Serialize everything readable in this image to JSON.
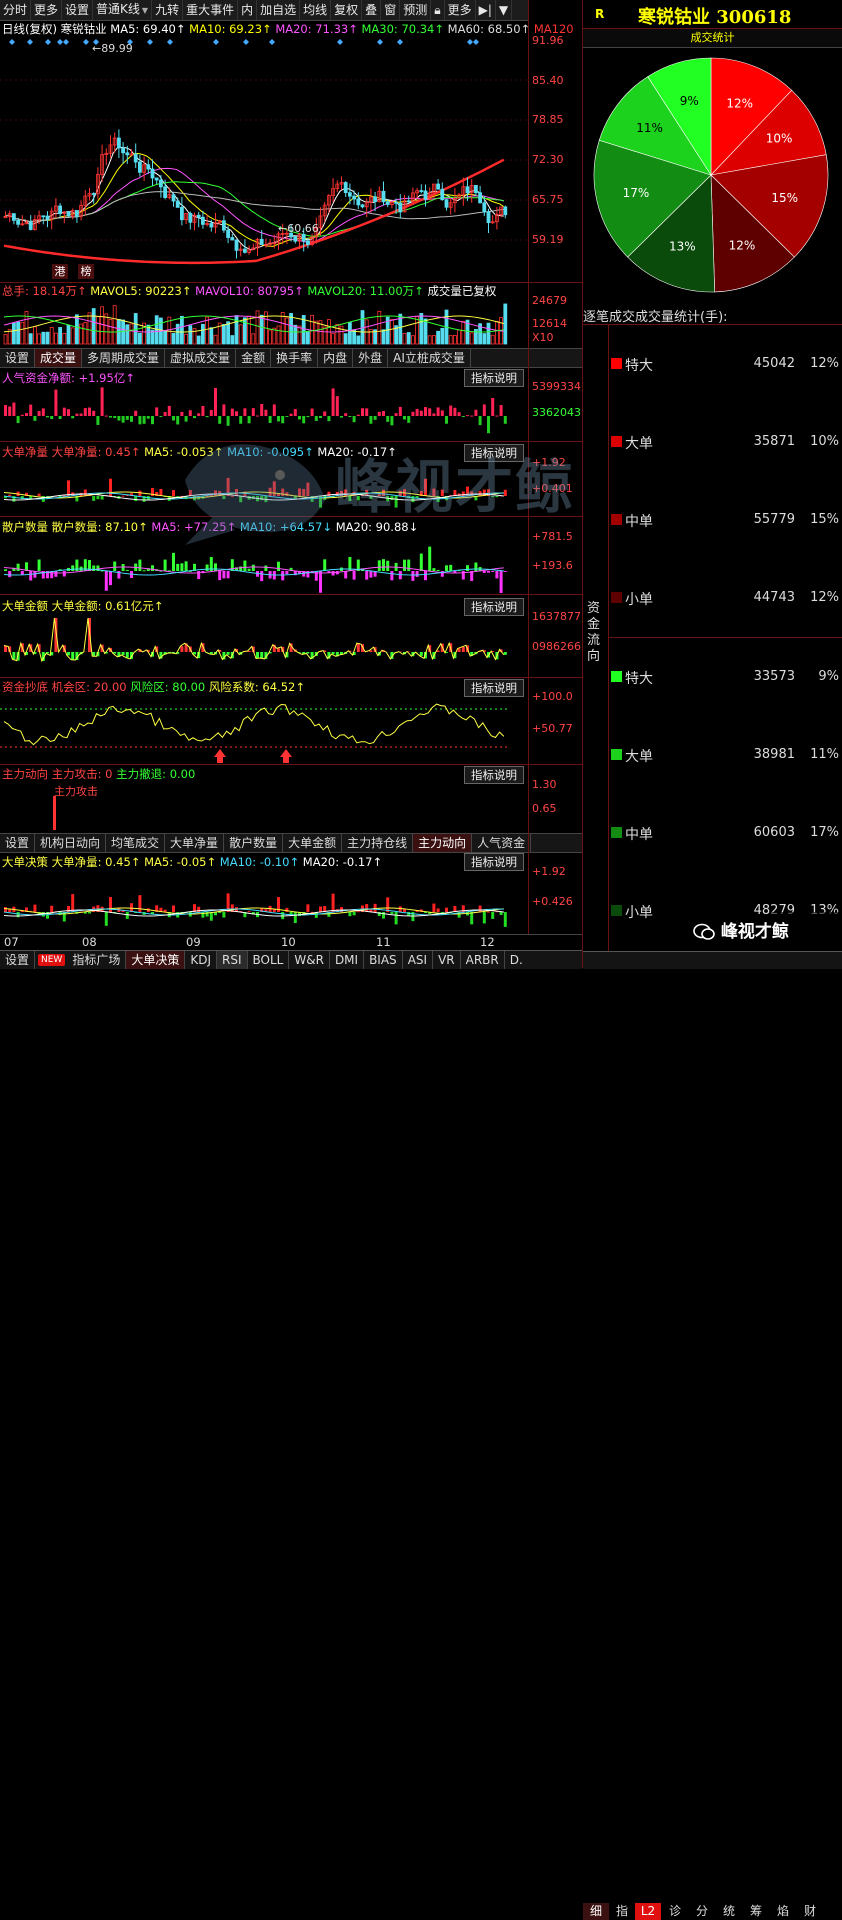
{
  "toolbar": {
    "items": [
      "分时",
      "更多",
      "设置",
      "普通K线",
      "九转",
      "重大事件",
      "内",
      "加自选",
      "均线",
      "复权",
      "叠",
      "窗",
      "预测",
      "更多"
    ]
  },
  "main_chart": {
    "legend": {
      "type": "日线(复权)",
      "name": "寒锐钴业",
      "ma5": "MA5: 69.40↑",
      "ma10": "MA10: 69.23↑",
      "ma20": "MA20: 71.33↑",
      "ma30": "MA30: 70.34↑",
      "ma60": "MA60: 68.50↑",
      "ma120": "MA120"
    },
    "y_ticks": [
      "91.96",
      "85.40",
      "78.85",
      "72.30",
      "65.75",
      "59.19"
    ],
    "high_label": "89.99",
    "low_label": "60.66",
    "tags": [
      "港",
      "榜"
    ]
  },
  "volume_panel": {
    "legend": {
      "total": "总手: 18.14万↑",
      "mavol5": "MAVOL5: 90223↑",
      "mavol10": "MAVOL10: 80795↑",
      "mavol20": "MAVOL20: 11.00万↑",
      "note": "成交量已复权"
    },
    "y_ticks": [
      "24679",
      "12614",
      "X10"
    ]
  },
  "tabs1": [
    "设置",
    "成交量",
    "多周期成交量",
    "虚拟成交量",
    "金额",
    "换手率",
    "内盘",
    "外盘",
    "AI立桩成交量"
  ],
  "indicator_panels": [
    {
      "title": "人气资金净额: +1.95亿↑",
      "btn": "指标说明",
      "y1": "5399334",
      "y2": "3362043"
    },
    {
      "title": "大单净量  大单净量: 0.45↑",
      "ma5": "MA5: -0.053↑",
      "ma10": "MA10: -0.095↑",
      "ma20": "MA20: -0.17↑",
      "btn": "指标说明",
      "y1": "+1.92",
      "y2": "+0.401"
    },
    {
      "title": "散户数量  散户数量: 87.10↑",
      "ma5": "MA5: +77.25↑",
      "ma10": "MA10: +64.57↓",
      "ma20": "MA20: 90.88↓",
      "btn": "指标说明",
      "y1": "+781.5",
      "y2": "+193.6"
    },
    {
      "title": "大单金额  大单金额: 0.61亿元↑",
      "btn": "指标说明",
      "y1": "1637877",
      "y2": "0986266"
    },
    {
      "title": "资金抄底",
      "ma5": "机会区: 20.00",
      "ma10": "风险区: 80.00",
      "ma20": "风险系数: 64.52↑",
      "btn": "指标说明",
      "y1": "+100.0",
      "y2": "+50.77"
    },
    {
      "title": "主力动向",
      "ma5": "主力攻击: 0",
      "ma10": "主力撤退: 0.00",
      "btn": "指标说明",
      "y1": "1.30",
      "y2": "0.65",
      "note": "主力攻击"
    }
  ],
  "tabs2": [
    "设置",
    "机构日动向",
    "均笔成交",
    "大单净量",
    "散户数量",
    "大单金额",
    "主力持仓线",
    "主力动向",
    "人气资金"
  ],
  "decision_panel": {
    "title": "大单决策  大单净量: 0.45↑",
    "ma5": "MA5: -0.05↑",
    "ma10": "MA10: -0.10↑",
    "ma20": "MA20: -0.17↑",
    "btn": "指标说明",
    "y1": "+1.92",
    "y2": "+0.426"
  },
  "x_labels": [
    "07",
    "08",
    "09",
    "10",
    "11",
    "12"
  ],
  "bottom_tabs": [
    "设置",
    "NEW",
    "指标广场",
    "大单决策",
    "KDJ",
    "RSI",
    "BOLL",
    "W&R",
    "DMI",
    "BIAS",
    "ASI",
    "VR",
    "ARBR",
    "D."
  ],
  "right_panel": {
    "r_mark": "R",
    "title": "寒锐钴业 300618",
    "pie_title": "成交统计",
    "pie": [
      {
        "pct": "12%",
        "pct_value": 12,
        "color": "#ff0000"
      },
      {
        "pct": "10%",
        "pct_value": 10,
        "color": "#dd0000"
      },
      {
        "pct": "15%",
        "pct_value": 15,
        "color": "#a50000"
      },
      {
        "pct": "12%",
        "pct_value": 12,
        "color": "#5e0000"
      },
      {
        "pct": "13%",
        "pct_value": 13,
        "color": "#0a4a0a"
      },
      {
        "pct": "17%",
        "pct_value": 17,
        "color": "#128c12"
      },
      {
        "pct": "11%",
        "pct_value": 11,
        "color": "#1cd21c"
      },
      {
        "pct": "9%",
        "pct_value": 9,
        "color": "#22ff22"
      }
    ],
    "stats_title": "逐笔成交成交量统计(手):",
    "side_label": "资金流向",
    "rows": [
      {
        "label": "特大",
        "value": "45042",
        "pct": "12%",
        "color": "#ff0000"
      },
      {
        "label": "大单",
        "value": "35871",
        "pct": "10%",
        "color": "#dd0000"
      },
      {
        "label": "中单",
        "value": "55779",
        "pct": "15%",
        "color": "#a50000"
      },
      {
        "label": "小单",
        "value": "44743",
        "pct": "12%",
        "color": "#5e0000"
      },
      {
        "label": "特大",
        "value": "33573",
        "pct": "9%",
        "color": "#22ff22"
      },
      {
        "label": "大单",
        "value": "38981",
        "pct": "11%",
        "color": "#1cd21c"
      },
      {
        "label": "中单",
        "value": "60603",
        "pct": "17%",
        "color": "#128c12"
      },
      {
        "label": "小单",
        "value": "48279",
        "pct": "13%",
        "color": "#0a4a0a"
      }
    ],
    "watermark": "峰视才鲸",
    "bottom_tabs": [
      "细",
      "指",
      "L2",
      "诊",
      "分",
      "统",
      "筹",
      "焰",
      "财"
    ]
  },
  "watermark_center": "峰视才鲸"
}
